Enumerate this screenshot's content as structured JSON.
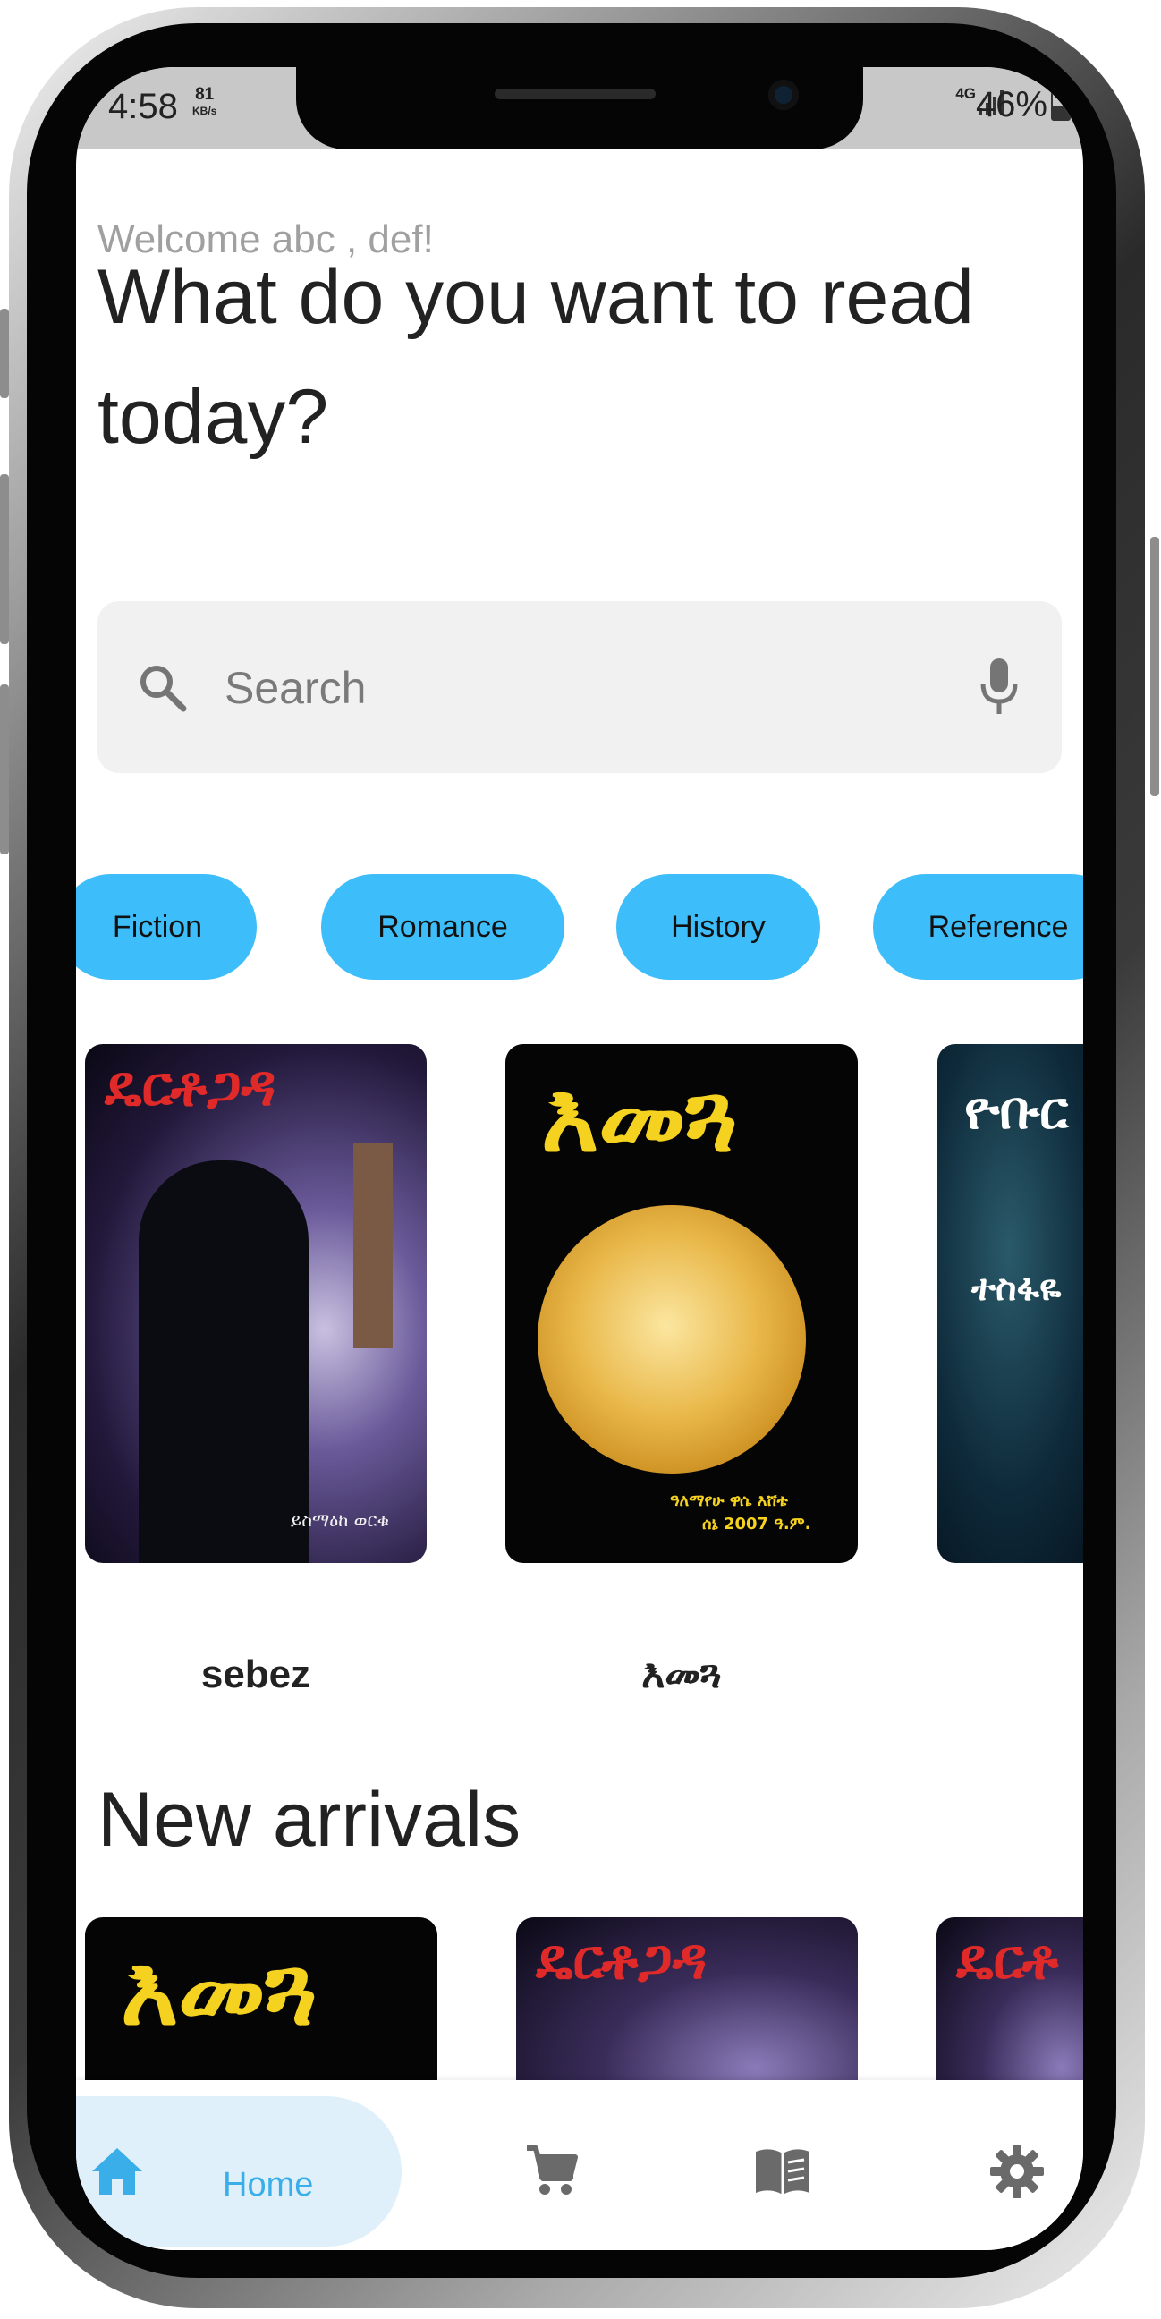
{
  "status_bar": {
    "time": "4:58",
    "net_speed": "81",
    "net_speed_unit": "KB/s",
    "network_type": "4G",
    "battery": "46%"
  },
  "header": {
    "welcome": "Welcome abc , def!",
    "headline": "What do you want to read today?"
  },
  "search": {
    "placeholder": "Search"
  },
  "categories": [
    "Fiction",
    "Romance",
    "History",
    "Reference"
  ],
  "featured_books": [
    {
      "cover_title": "ዴርቶጋዳ",
      "cover_author": "ይስማዕከ ወርቁ",
      "label": "sebez"
    },
    {
      "cover_title": "እመጓ",
      "cover_author": "ዓለማየሁ ዋሴ እሸቴ",
      "cover_date": "ሰኔ 2007 ዓ.ም.",
      "label": "እመጓ"
    },
    {
      "cover_title": "ዮቡር",
      "cover_author": "ተስፋዬ",
      "label": ""
    }
  ],
  "new_arrivals": {
    "title": "New arrivals",
    "books": [
      {
        "cover_title": "እመጓ"
      },
      {
        "cover_title": "ዴርቶጋዳ"
      },
      {
        "cover_title": "ዴርቶ"
      }
    ]
  },
  "bottom_nav": {
    "home_label": "Home",
    "accent": "#3aaee8"
  },
  "colors": {
    "chip": "#3dbefa",
    "nav_active_bg": "#dff0fb"
  }
}
